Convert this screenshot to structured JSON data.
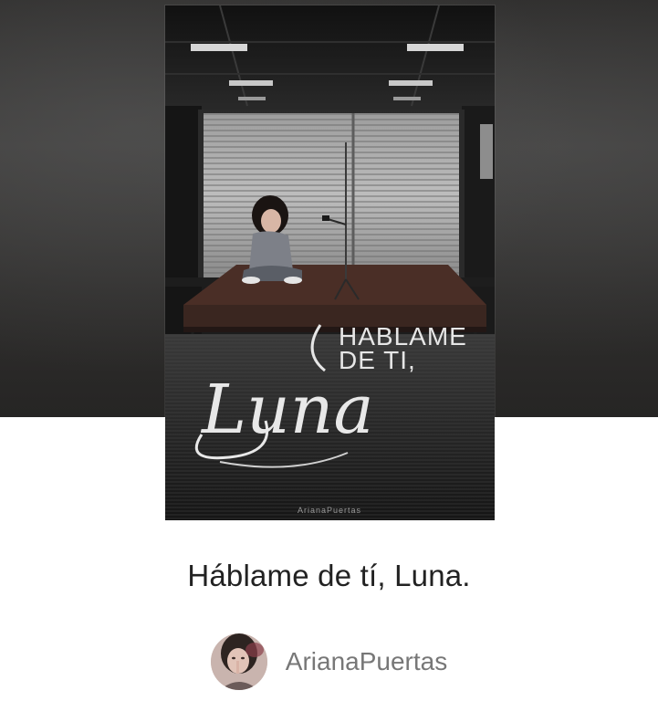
{
  "story": {
    "title": "Háblame de tí, Luna.",
    "author": "ArianaPuertas"
  },
  "cover": {
    "title_line1": "HABLAME",
    "title_line2": "DE TI,",
    "title_script": "Luna",
    "credit": "ArianaPuertas"
  },
  "icons": {
    "avatar": "author-avatar-photo"
  },
  "colors": {
    "hero_background": "#2f2e2d",
    "title_text": "#222222",
    "author_text": "#777777",
    "page_background": "#ffffff"
  }
}
